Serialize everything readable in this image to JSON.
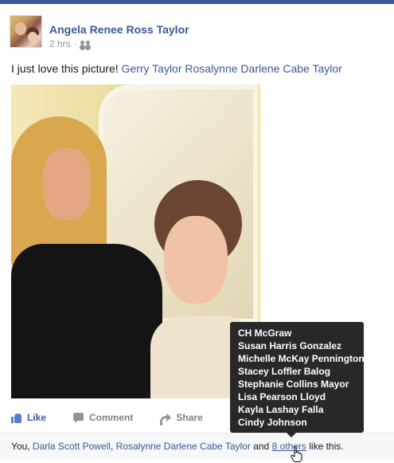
{
  "post": {
    "author": "Angela Renee Ross Taylor",
    "time": "2 hrs",
    "privacy_separator": "·",
    "privacy_icon": "friends-icon",
    "text": "I just love this picture!",
    "tagged": "Gerry Taylor Rosalynne Darlene Cabe Taylor"
  },
  "actions": {
    "like": "Like",
    "comment": "Comment",
    "share": "Share"
  },
  "likes": {
    "prefix": "You, ",
    "person1": "Darla Scott Powell",
    "sep1": ", ",
    "person2": "Rosalynne Darlene Cabe Taylor",
    "sep2": " and ",
    "others_link": "8 others",
    "suffix": " like this."
  },
  "tooltip": {
    "names": [
      "CH McGraw",
      "Susan Harris Gonzalez",
      "Michelle McKay Pennington",
      "Stacey Loffler Balog",
      "Stephanie Collins Mayor",
      "Lisa Pearson Lloyd",
      "Kayla Lashay Falla",
      "Cindy Johnson"
    ]
  },
  "colors": {
    "link": "#3b5998",
    "muted": "#90949c",
    "tooltip_bg": "#282828"
  }
}
